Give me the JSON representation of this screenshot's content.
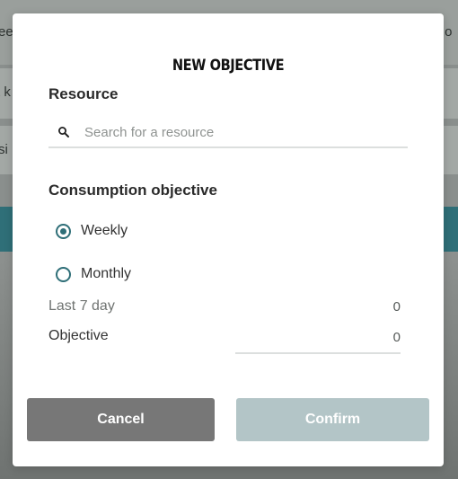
{
  "background": {
    "top_left_text": "ee",
    "top_right_text": "r o",
    "row1_text": "t k",
    "row2_text": "si"
  },
  "modal": {
    "title": "NEW OBJECTIVE",
    "resource": {
      "label": "Resource",
      "search_placeholder": "Search for a resource",
      "search_value": "",
      "search_icon": "search-icon"
    },
    "consumption": {
      "label": "Consumption objective",
      "options": [
        {
          "label": "Weekly",
          "selected": true
        },
        {
          "label": "Monthly",
          "selected": false
        }
      ]
    },
    "last7": {
      "label": "Last 7 day",
      "value": "0"
    },
    "objective": {
      "label": "Objective",
      "value": "0"
    },
    "buttons": {
      "cancel": "Cancel",
      "confirm": "Confirm"
    }
  },
  "colors": {
    "accent": "#2f6f78",
    "cancel_button": "#777777",
    "confirm_button_disabled": "#b3c5c7",
    "overlay": "#8a8f8d"
  }
}
